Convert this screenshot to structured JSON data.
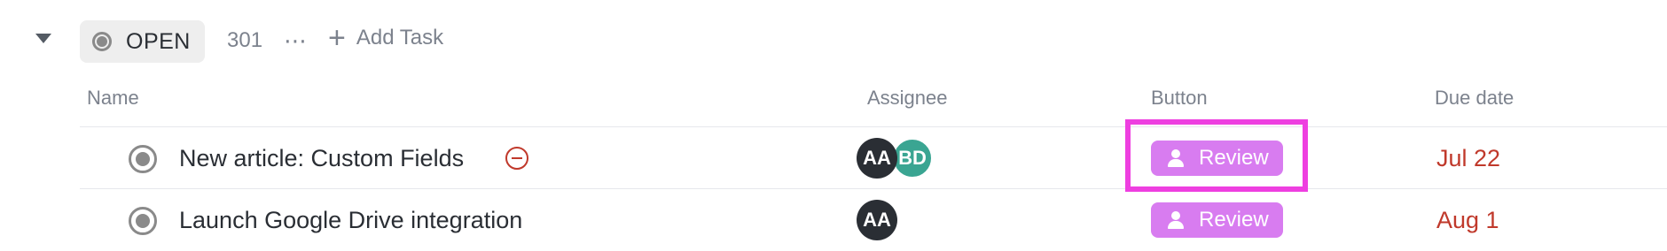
{
  "group": {
    "status_label": "OPEN",
    "task_count": "301",
    "more_glyph": "⋯",
    "add_task_label": "Add Task",
    "add_glyph": "+"
  },
  "columns": {
    "name": "Name",
    "assignee": "Assignee",
    "button": "Button",
    "due_date": "Due date"
  },
  "tasks": [
    {
      "name": "New article: Custom Fields",
      "assignees": [
        "AA",
        "BD"
      ],
      "button_label": "Review",
      "due": "Jul 22",
      "priority_icon": "urgent-minus-circle-icon"
    },
    {
      "name": "Launch Google Drive integration",
      "assignees": [
        "AA"
      ],
      "button_label": "Review",
      "due": "Aug 1"
    }
  ],
  "colors": {
    "button_bg": "#d87cf0",
    "highlight": "#ee3fe0",
    "due_overdue": "#c0392b",
    "avatar_aa": "#2a2e34",
    "avatar_bd": "#3aa592"
  }
}
